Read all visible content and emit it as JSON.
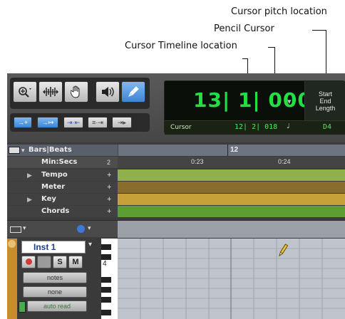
{
  "callouts": {
    "cursor_pitch": "Cursor pitch location",
    "pencil_cursor": "Pencil Cursor",
    "cursor_timeline": "Cursor Timeline location"
  },
  "counter": {
    "main": "13| 1| 000",
    "cursor_label": "Cursor",
    "cursor_time": "12| 2| 018",
    "cursor_pitch": "D4",
    "start": "Start",
    "end": "End",
    "length": "Length"
  },
  "rulers": {
    "bars_beats": "Bars|Beats",
    "bar_12": "12",
    "min_secs": "Min:Secs",
    "time_0_23": "0:23",
    "time_0_24": "0:24",
    "time_left": "2",
    "tempo": "Tempo",
    "meter": "Meter",
    "key": "Key",
    "chords": "Chords",
    "plus": "+"
  },
  "track": {
    "name": "Inst 1",
    "solo": "S",
    "mute": "M",
    "view": "notes",
    "automation_sub": "none",
    "automation_mode": "auto read",
    "octave": "4"
  },
  "colors": {
    "tempo_lane": "#8fb04a",
    "meter_lane": "#8a6d2c",
    "key_lane": "#c6a038",
    "chords_lane": "#5c9e34",
    "track_color": "#c98b2c",
    "counter_green": "#22e043"
  }
}
